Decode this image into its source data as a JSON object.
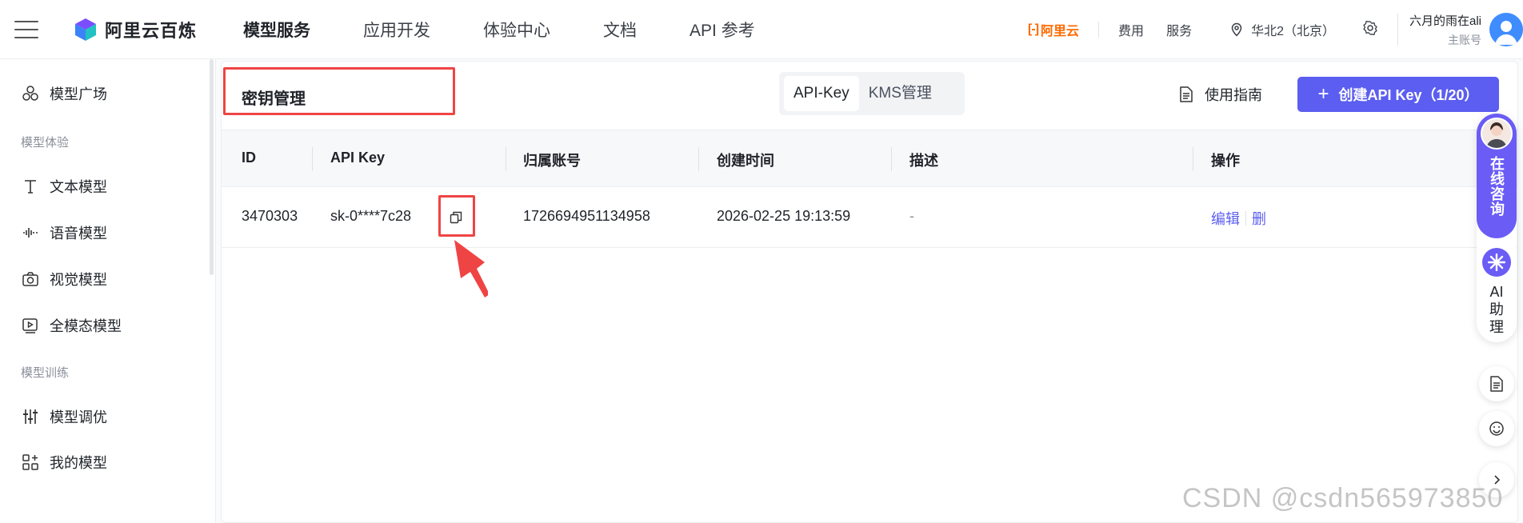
{
  "app": {
    "brand": "阿里云百炼",
    "aliyun": "阿里云",
    "aliyun_mark": "[-]"
  },
  "nav": {
    "items": [
      "模型服务",
      "应用开发",
      "体验中心",
      "文档",
      "API 参考"
    ]
  },
  "topright": {
    "fee": "费用",
    "service": "服务",
    "region": "华北2（北京）",
    "user_name": "六月的雨在ali",
    "user_role": "主账号"
  },
  "sidebar": {
    "model_square": "模型广场",
    "group_experience": "模型体验",
    "text_model": "文本模型",
    "voice_model": "语音模型",
    "vision_model": "视觉模型",
    "omni_model": "全模态模型",
    "group_training": "模型训练",
    "tuning": "模型调优",
    "my_models": "我的模型"
  },
  "page": {
    "title": "密钥管理",
    "tabs": [
      "API-Key",
      "KMS管理"
    ],
    "guide": "使用指南",
    "create": "创建API Key（1/20）"
  },
  "table": {
    "headers": [
      "ID",
      "API Key",
      "归属账号",
      "创建时间",
      "描述",
      "操作"
    ],
    "rows": [
      {
        "id": "3470303",
        "key": "sk-0****7c28",
        "account": "1726694951134958",
        "created": "2026-02-25 19:13:59",
        "desc": "-",
        "edit": "编辑",
        "del": "删"
      }
    ]
  },
  "dock": {
    "consult": "在线咨询",
    "ai": "AI助理",
    "ai_line1": "AI",
    "ai_line2": "助",
    "ai_line3": "理"
  },
  "watermark": "CSDN @csdn565973850",
  "colors": {
    "accent": "#5b5ef0",
    "highlight": "#ef4444",
    "aliyun_orange": "#ff6a00"
  }
}
